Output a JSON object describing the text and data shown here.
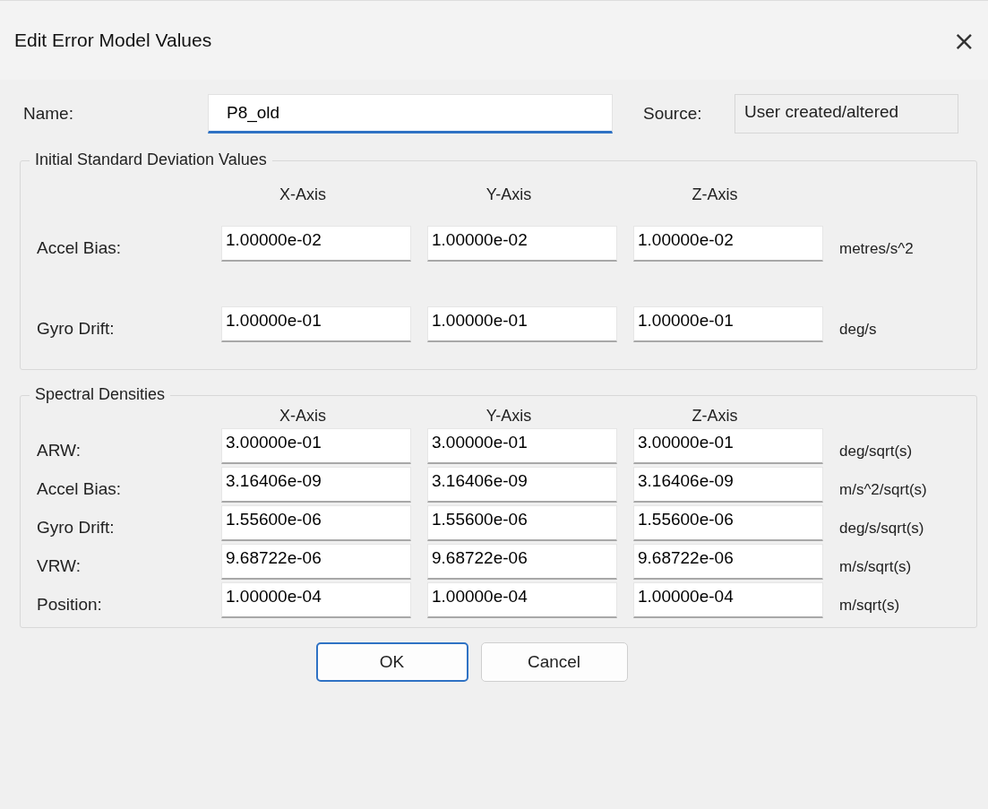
{
  "window": {
    "title": "Edit Error Model Values",
    "close": "×"
  },
  "name_field": {
    "label": "Name:",
    "value": "P8_old",
    "focused": true
  },
  "source_field": {
    "label": "Source:",
    "value": "User created/altered"
  },
  "groups": [
    {
      "title": "Initial Standard Deviation Values",
      "columns": [
        "X-Axis",
        "Y-Axis",
        "Z-Axis"
      ],
      "rows": [
        {
          "label": "Accel Bias:",
          "values": [
            "1.00000e-02",
            "1.00000e-02",
            "1.00000e-02"
          ],
          "unit": "metres/s^2"
        },
        {
          "label": "Gyro Drift:",
          "values": [
            "1.00000e-01",
            "1.00000e-01",
            "1.00000e-01"
          ],
          "unit": "deg/s"
        }
      ]
    },
    {
      "title": "Spectral Densities",
      "columns": [
        "X-Axis",
        "Y-Axis",
        "Z-Axis"
      ],
      "rows": [
        {
          "label": "ARW:",
          "values": [
            "3.00000e-01",
            "3.00000e-01",
            "3.00000e-01"
          ],
          "unit": "deg/sqrt(s)"
        },
        {
          "label": "Accel Bias:",
          "values": [
            "3.16406e-09",
            "3.16406e-09",
            "3.16406e-09"
          ],
          "unit": "m/s^2/sqrt(s)"
        },
        {
          "label": "Gyro Drift:",
          "values": [
            "1.55600e-06",
            "1.55600e-06",
            "1.55600e-06"
          ],
          "unit": "deg/s/sqrt(s)"
        },
        {
          "label": "VRW:",
          "values": [
            "9.68722e-06",
            "9.68722e-06",
            "9.68722e-06"
          ],
          "unit": "m/s/sqrt(s)"
        },
        {
          "label": "Position:",
          "values": [
            "1.00000e-04",
            "1.00000e-04",
            "1.00000e-04"
          ],
          "unit": "m/sqrt(s)"
        }
      ]
    }
  ],
  "buttons": [
    {
      "label": "OK",
      "default": true
    },
    {
      "label": "Cancel",
      "default": false
    }
  ]
}
